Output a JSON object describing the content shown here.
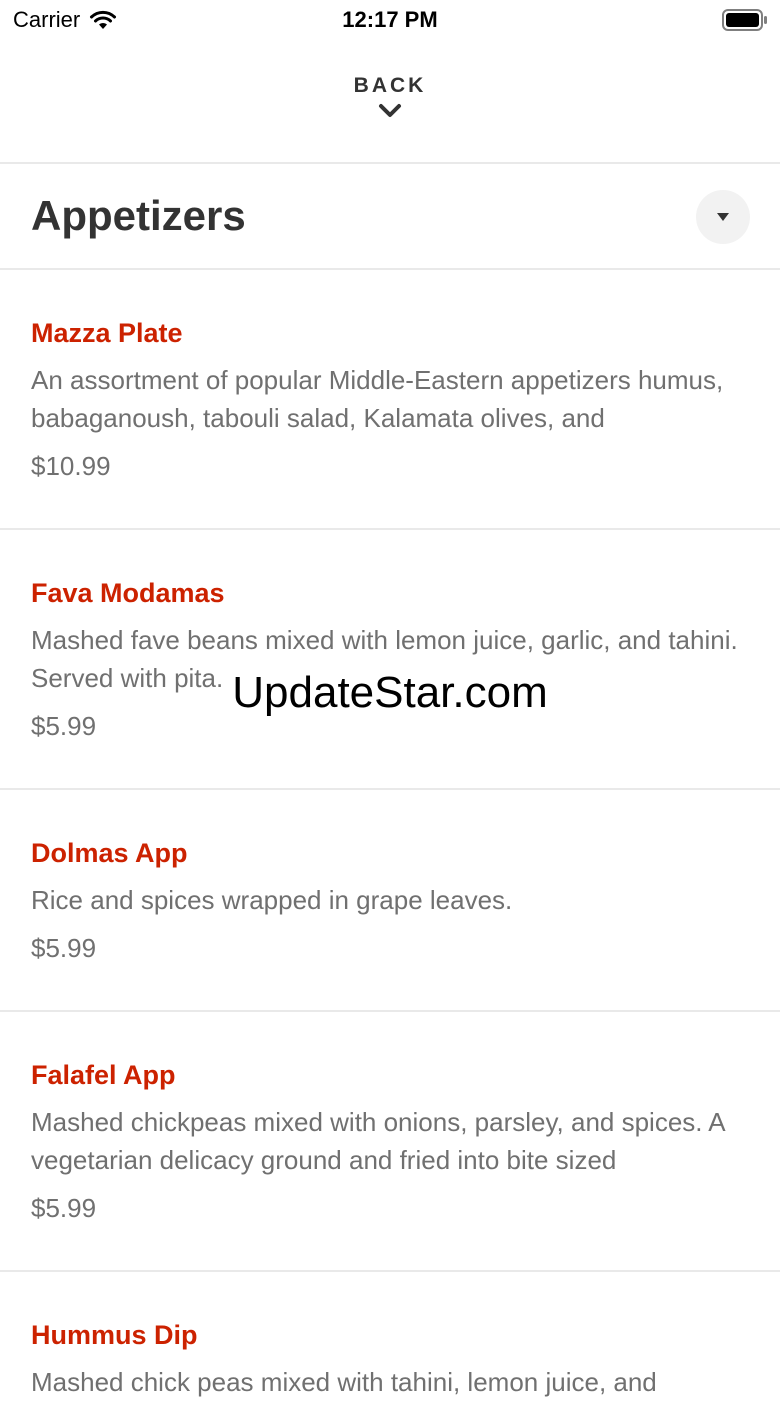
{
  "status_bar": {
    "carrier": "Carrier",
    "time": "12:17 PM"
  },
  "nav": {
    "back_label": "BACK"
  },
  "section": {
    "title": "Appetizers"
  },
  "menu_items": [
    {
      "name": "Mazza Plate",
      "description": "An assortment of popular Middle-Eastern appetizers humus, babaganoush, tabouli salad, Kalamata olives, and",
      "price": "$10.99"
    },
    {
      "name": "Fava Modamas",
      "description": "Mashed fave beans mixed with lemon juice, garlic, and tahini. Served with pita.",
      "price": "$5.99"
    },
    {
      "name": "Dolmas App",
      "description": "Rice and spices wrapped in grape leaves.",
      "price": "$5.99"
    },
    {
      "name": "Falafel App",
      "description": "Mashed chickpeas mixed with onions, parsley, and spices. A vegetarian delicacy ground and fried into bite sized",
      "price": "$5.99"
    },
    {
      "name": "Hummus Dip",
      "description": "Mashed chick peas mixed with tahini, lemon juice, and",
      "price": ""
    }
  ],
  "watermark": "UpdateStar.com",
  "colors": {
    "item_name": "#cc2200",
    "text_secondary": "#707070",
    "divider": "#e9e9e9"
  },
  "icons": [
    "wifi-icon",
    "battery-icon",
    "chevron-down-icon",
    "caret-down-icon"
  ]
}
